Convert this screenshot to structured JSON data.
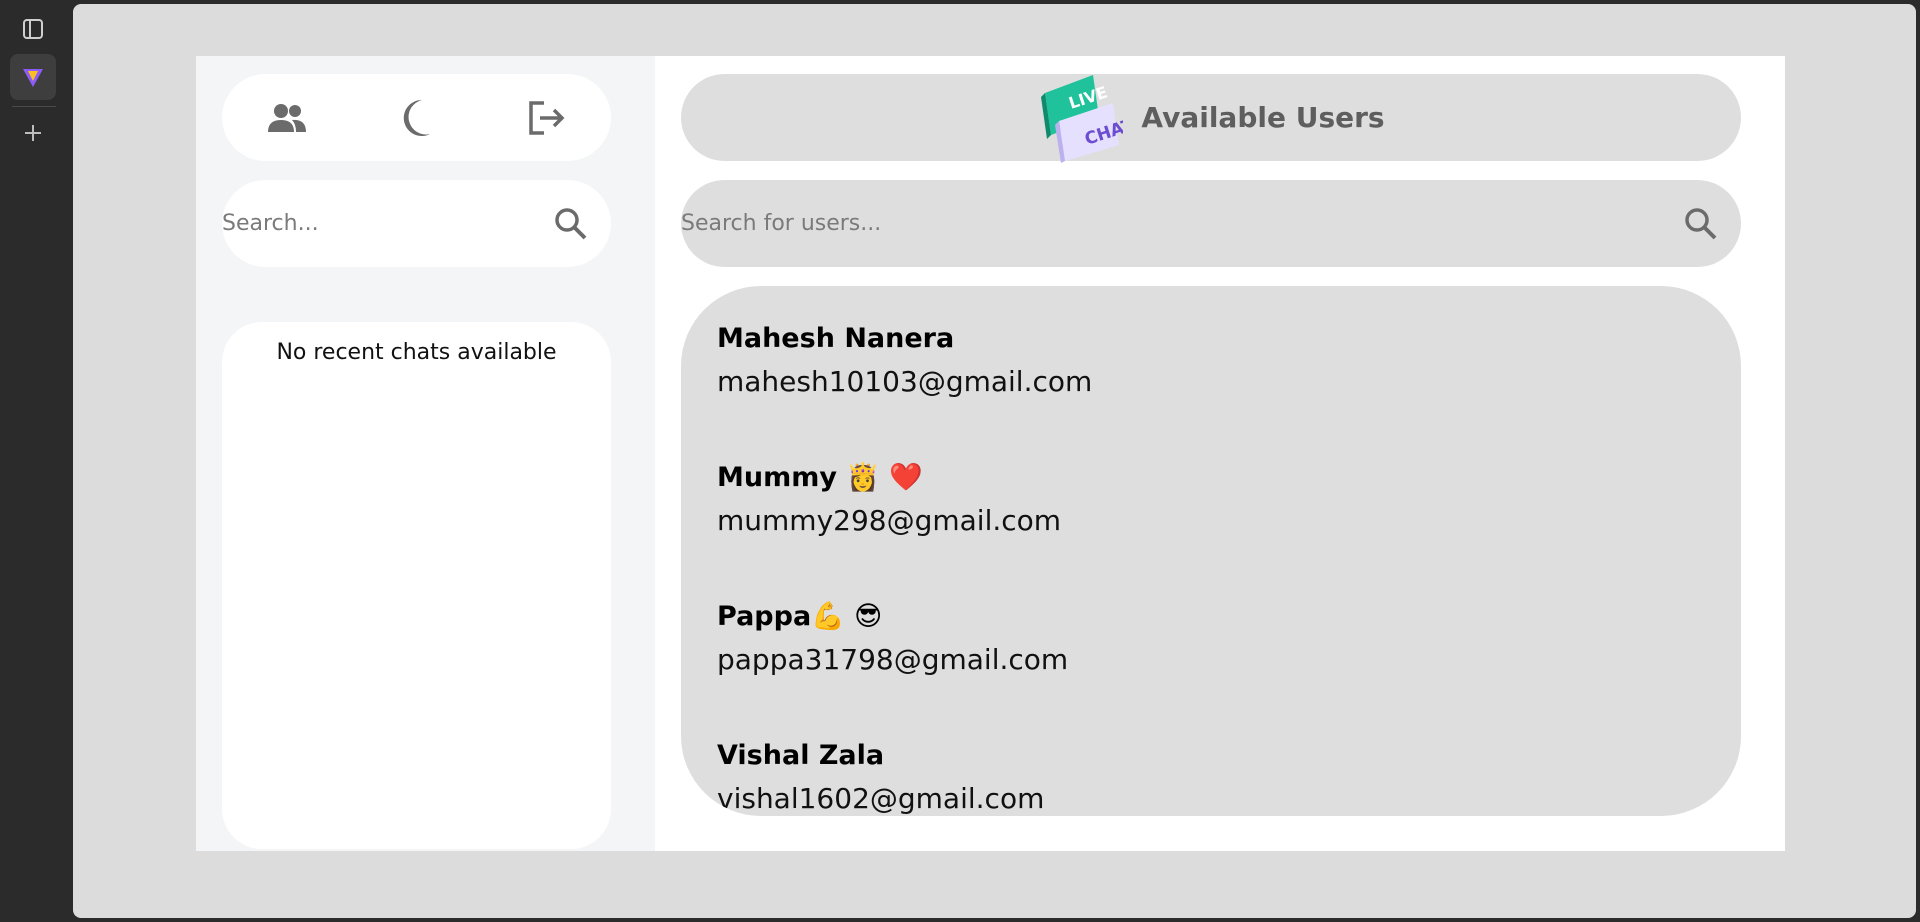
{
  "sidebar": {
    "search_placeholder": "Search...",
    "empty_text": "No recent chats available",
    "icons": [
      "users-icon",
      "moon-icon",
      "logout-icon"
    ]
  },
  "main": {
    "header_title": "Available Users",
    "logo_text": {
      "line1": "LIVE",
      "line2": "CHAT"
    },
    "search_placeholder": "Search for users...",
    "users": [
      {
        "name": "Mahesh Nanera",
        "email": "mahesh10103@gmail.com"
      },
      {
        "name": "Mummy 👸 ❤️",
        "email": "mummy298@gmail.com"
      },
      {
        "name": "Pappa💪 😎",
        "email": "pappa31798@gmail.com"
      },
      {
        "name": "Vishal Zala",
        "email": "vishal1602@gmail.com"
      }
    ]
  },
  "colors": {
    "background": "#dcdcdc",
    "panel": "#dedede",
    "icon": "#6b6b6b",
    "logo_green": "#1fc29a",
    "logo_purple": "#6c4cd1"
  }
}
